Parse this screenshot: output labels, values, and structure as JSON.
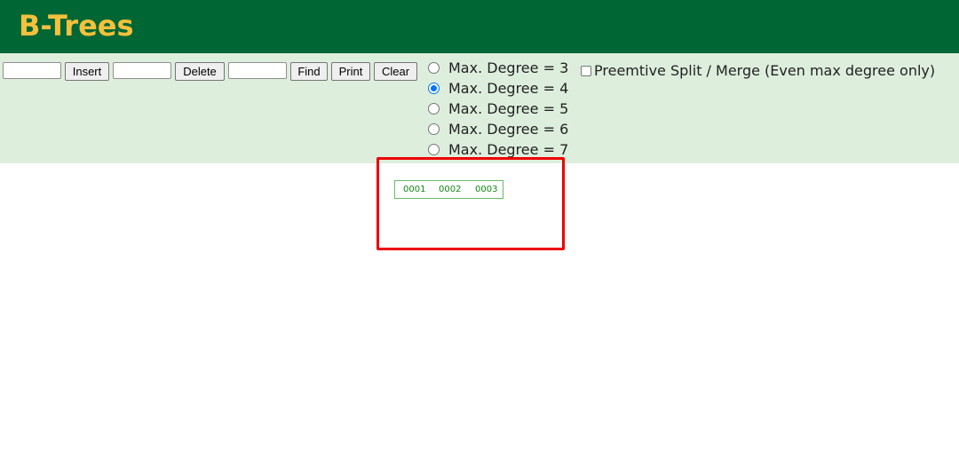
{
  "header": {
    "title": "B-Trees"
  },
  "toolbar": {
    "insert_input_value": "",
    "insert_label": "Insert",
    "delete_input_value": "",
    "delete_label": "Delete",
    "find_input_value": "",
    "find_label": "Find",
    "print_label": "Print",
    "clear_label": "Clear"
  },
  "degree_options": [
    {
      "label": "Max. Degree = 3",
      "checked": false
    },
    {
      "label": "Max. Degree = 4",
      "checked": true
    },
    {
      "label": "Max. Degree = 5",
      "checked": false
    },
    {
      "label": "Max. Degree = 6",
      "checked": false
    },
    {
      "label": "Max. Degree = 7",
      "checked": false
    }
  ],
  "preemptive": {
    "label": "Preemtive Split / Merge (Even max degree only)",
    "checked": false
  },
  "tree": {
    "root_keys": [
      "0001",
      "0002",
      "0003"
    ]
  },
  "colors": {
    "header_bg": "#006633",
    "title_color": "#f5c03c",
    "controls_bg": "#ddeedd",
    "node_border": "#66bb66",
    "node_text": "#118811",
    "highlight": "#ee0000"
  }
}
